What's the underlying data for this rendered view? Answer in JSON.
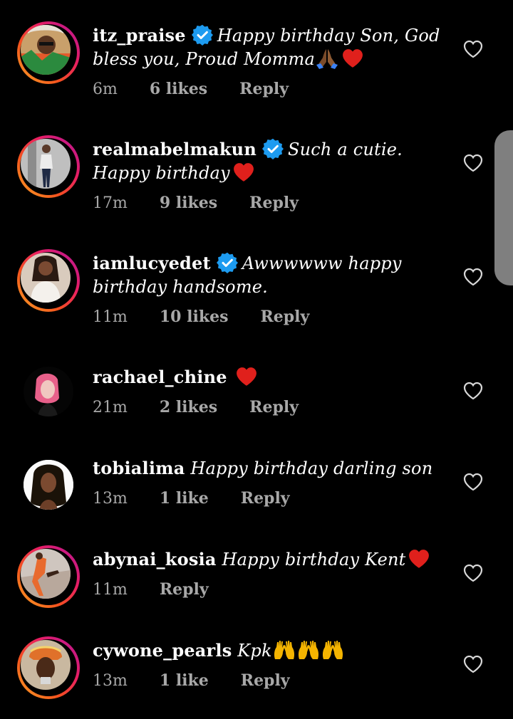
{
  "comments": [
    {
      "username": "itz_praise",
      "verified": true,
      "text": "Happy birthday Son, God bless you, Proud Momma",
      "emoji": [
        "folded-hands",
        "red-heart"
      ],
      "time": "6m",
      "likes": "6 likes",
      "reply": "Reply",
      "story_ring": true
    },
    {
      "username": "realmabelmakun",
      "verified": true,
      "text": "Such a cutie. Happy birthday",
      "emoji": [
        "red-heart"
      ],
      "time": "17m",
      "likes": "9 likes",
      "reply": "Reply",
      "story_ring": true
    },
    {
      "username": "iamlucyedet",
      "verified": true,
      "text": "Awwwwww happy birthday handsome.",
      "emoji": [],
      "time": "11m",
      "likes": "10 likes",
      "reply": "Reply",
      "story_ring": true
    },
    {
      "username": "rachael_chine",
      "verified": false,
      "text": "",
      "emoji": [
        "red-heart"
      ],
      "time": "21m",
      "likes": "2 likes",
      "reply": "Reply",
      "story_ring": false
    },
    {
      "username": "tobialima",
      "verified": false,
      "text": "Happy birthday darling son",
      "emoji": [],
      "time": "13m",
      "likes": "1 like",
      "reply": "Reply",
      "story_ring": false
    },
    {
      "username": "abynai_kosia",
      "verified": false,
      "text": "Happy birthday Kent",
      "emoji": [
        "red-heart"
      ],
      "time": "11m",
      "likes": "",
      "reply": "Reply",
      "story_ring": true
    },
    {
      "username": "cywone_pearls",
      "verified": false,
      "text": "Kpk",
      "emoji": [
        "raising-hands",
        "raising-hands",
        "raising-hands"
      ],
      "time": "13m",
      "likes": "1 like",
      "reply": "Reply",
      "story_ring": true
    }
  ],
  "colors": {
    "background": "#000000",
    "secondary_text": "#a8a8a8",
    "verified_blue": "#1d9bf0",
    "heart_red": "#e0201c"
  }
}
